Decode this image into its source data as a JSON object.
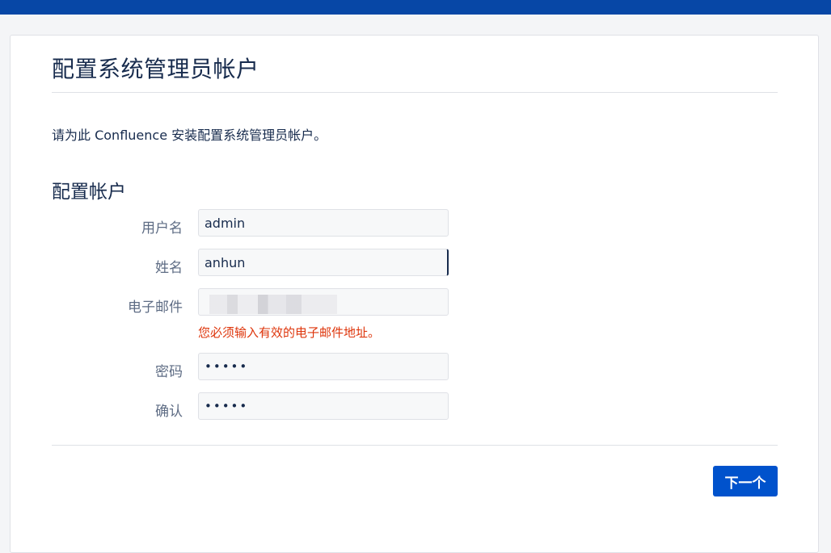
{
  "page": {
    "title": "配置系统管理员帐户",
    "intro": "请为此 Confluence 安装配置系统管理员帐户。"
  },
  "form": {
    "section_title": "配置帐户",
    "username": {
      "label": "用户名",
      "value": "admin"
    },
    "fullname": {
      "label": "姓名",
      "value": "anhun"
    },
    "email": {
      "label": "电子邮件",
      "value": "",
      "error": "您必须输入有效的电子邮件地址。"
    },
    "password": {
      "label": "密码",
      "value": "•••••"
    },
    "confirm": {
      "label": "确认",
      "value": "•••••"
    }
  },
  "actions": {
    "next_label": "下一个"
  },
  "colors": {
    "topbar": "#0747a6",
    "primary_button": "#0052cc",
    "error": "#de350b"
  }
}
